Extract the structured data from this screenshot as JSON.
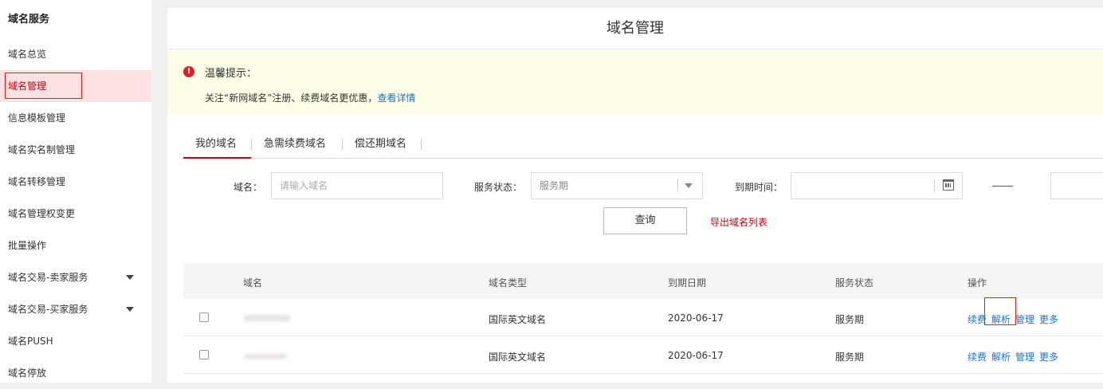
{
  "sidebar": {
    "title": "域名服务",
    "items": [
      {
        "label": "域名总览",
        "active": false,
        "has_caret": false
      },
      {
        "label": "域名管理",
        "active": true,
        "has_caret": false
      },
      {
        "label": "信息模板管理",
        "active": false,
        "has_caret": false
      },
      {
        "label": "域名实名制管理",
        "active": false,
        "has_caret": false
      },
      {
        "label": "域名转移管理",
        "active": false,
        "has_caret": false
      },
      {
        "label": "域名管理权变更",
        "active": false,
        "has_caret": false
      },
      {
        "label": "批量操作",
        "active": false,
        "has_caret": false
      },
      {
        "label": "域名交易-卖家服务",
        "active": false,
        "has_caret": true
      },
      {
        "label": "域名交易-买家服务",
        "active": false,
        "has_caret": true
      },
      {
        "label": "域名PUSH",
        "active": false,
        "has_caret": false
      },
      {
        "label": "域名停放",
        "active": false,
        "has_caret": false
      }
    ]
  },
  "main": {
    "title": "域名管理",
    "notice": {
      "icon": "warning-icon",
      "title": "温馨提示：",
      "text": "关注“新网域名”注册、续费域名更优惠，",
      "link": "查看详情"
    },
    "tabs": [
      {
        "label": "我的域名",
        "active": true
      },
      {
        "label": "急需续费域名",
        "active": false
      },
      {
        "label": "偿还期域名",
        "active": false
      }
    ],
    "filters": {
      "domain_label": "域名：",
      "domain_placeholder": "请输入域名",
      "status_label": "服务状态：",
      "status_value": "服务期",
      "expire_label": "到期时间：",
      "expire_start": "",
      "expire_end": ""
    },
    "query_button": "查询",
    "export_link": "导出域名列表",
    "table": {
      "columns": [
        "域名",
        "域名类型",
        "到期日期",
        "服务状态",
        "操作"
      ],
      "rows": [
        {
          "domain": "",
          "type": "国际英文域名",
          "expire": "2020-06-17",
          "status": "服务期",
          "ops": [
            "续费",
            "解析",
            "管理",
            "更多"
          ]
        },
        {
          "domain": "",
          "type": "国际英文域名",
          "expire": "2020-06-17",
          "status": "服务期",
          "ops": [
            "续费",
            "解析",
            "管理",
            "更多"
          ]
        }
      ]
    }
  },
  "colors": {
    "accent": "#c7000b",
    "link": "#1a73c9",
    "notice_bg": "#fdfde8",
    "active_bg": "#fde2e4"
  }
}
